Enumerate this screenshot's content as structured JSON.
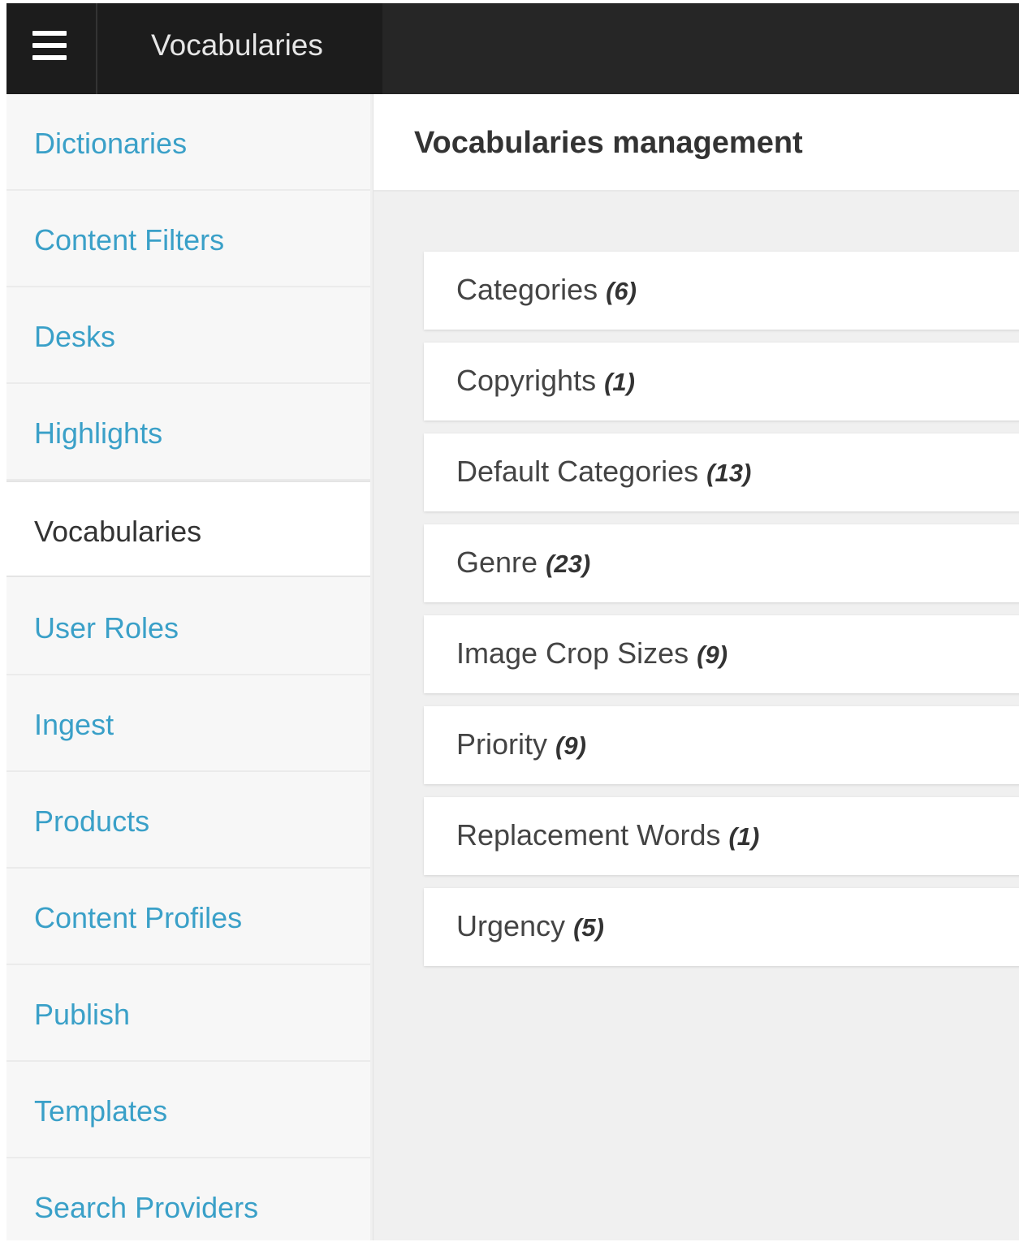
{
  "topbar": {
    "menu_icon": "hamburger-menu-icon",
    "title": "Vocabularies"
  },
  "sidebar": {
    "items": [
      {
        "label": "Dictionaries",
        "active": false
      },
      {
        "label": "Content Filters",
        "active": false
      },
      {
        "label": "Desks",
        "active": false
      },
      {
        "label": "Highlights",
        "active": false
      },
      {
        "label": "Vocabularies",
        "active": true
      },
      {
        "label": "User Roles",
        "active": false
      },
      {
        "label": "Ingest",
        "active": false
      },
      {
        "label": "Products",
        "active": false
      },
      {
        "label": "Content Profiles",
        "active": false
      },
      {
        "label": "Publish",
        "active": false
      },
      {
        "label": "Templates",
        "active": false
      },
      {
        "label": "Search Providers",
        "active": false
      }
    ]
  },
  "main": {
    "title": "Vocabularies management",
    "vocabularies": [
      {
        "name": "Categories",
        "count": "(6)"
      },
      {
        "name": "Copyrights",
        "count": "(1)"
      },
      {
        "name": "Default Categories",
        "count": "(13)"
      },
      {
        "name": "Genre",
        "count": "(23)"
      },
      {
        "name": "Image Crop Sizes",
        "count": "(9)"
      },
      {
        "name": "Priority",
        "count": "(9)"
      },
      {
        "name": "Replacement Words",
        "count": "(1)"
      },
      {
        "name": "Urgency",
        "count": "(5)"
      }
    ]
  },
  "colors": {
    "topbar": "#262626",
    "link": "#3aa0c8",
    "active_text": "#333333"
  }
}
